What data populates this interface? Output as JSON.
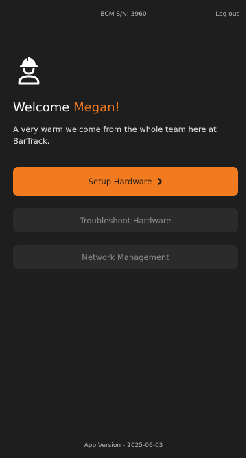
{
  "header": {
    "serial": "BCM S/N: 3960",
    "logout_label": "Log out"
  },
  "user_icon": "worker-helmet-icon",
  "welcome": {
    "prefix": "Welcome",
    "name": "Megan!",
    "message": "A very warm welcome from the whole team here at BarTrack."
  },
  "actions": {
    "setup_label": "Setup Hardware",
    "setup_icon": "chevron-right-icon",
    "troubleshoot_label": "Troubleshoot Hardware",
    "network_label": "Network Management"
  },
  "footer": {
    "version": "App Version - 2025-06-03"
  },
  "colors": {
    "accent": "#f27a1f",
    "background": "#1e1e1e",
    "secondary_button": "#2b2b2b"
  }
}
